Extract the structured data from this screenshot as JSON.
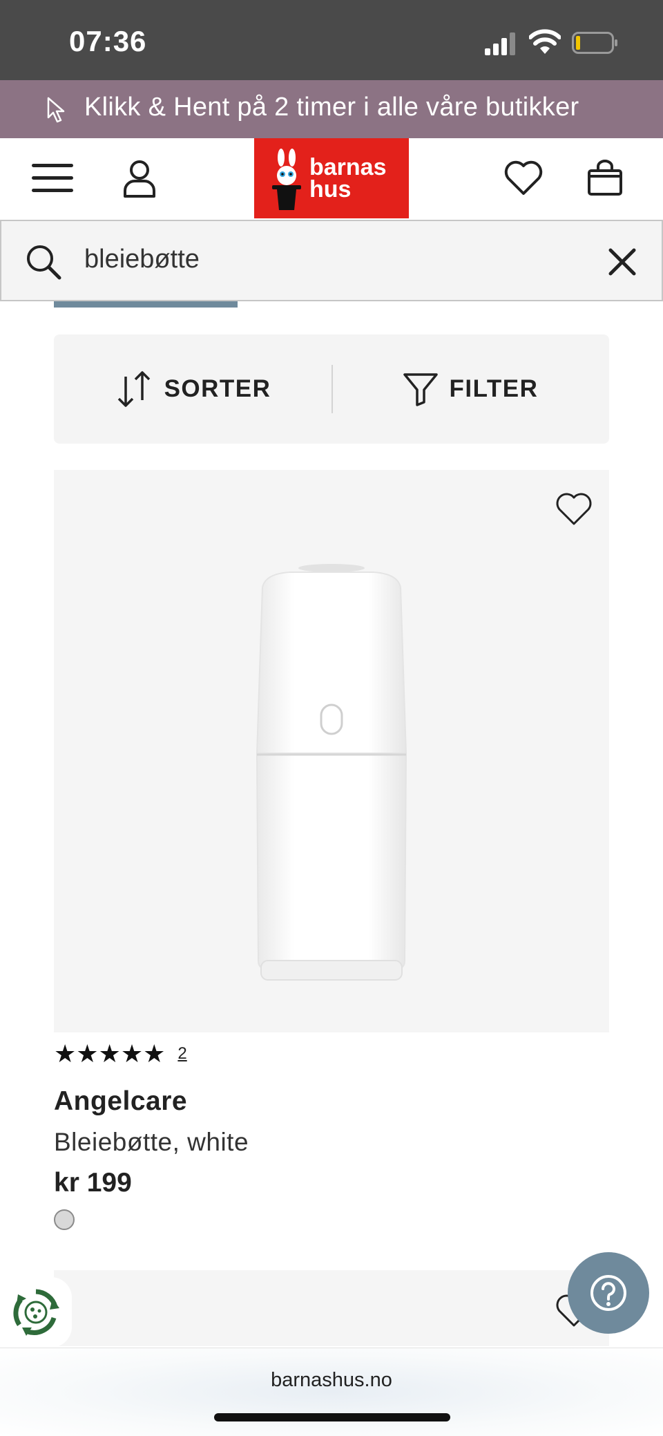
{
  "status_bar": {
    "time": "07:36",
    "icons": [
      "cellular-signal-icon",
      "wifi-icon",
      "battery-low-icon"
    ]
  },
  "promo": {
    "icon": "cursor-pointer-icon",
    "text": "Klikk & Hent på 2 timer i alle våre butikker"
  },
  "header": {
    "logo_line1": "barnas",
    "logo_line2": "hus",
    "icons": [
      "hamburger-menu-icon",
      "user-icon",
      "heart-icon",
      "shopping-bag-icon"
    ]
  },
  "search": {
    "value": "bleiebøtte",
    "icon": "search-icon",
    "clear_icon": "close-icon"
  },
  "toolbar": {
    "sort_label": "SORTER",
    "filter_label": "FILTER"
  },
  "products": [
    {
      "stars": "★★★★★",
      "rating_value": 5,
      "review_count": "2",
      "brand": "Angelcare",
      "name": "Bleiebøtte, white",
      "price": "kr 199",
      "swatch_color": "#d8d8d8"
    }
  ],
  "bottom": {
    "url": "barnashus.no"
  },
  "colors": {
    "status_bar": "#4a4a4a",
    "promo_bg": "#8c7384",
    "logo_bg": "#e3211b",
    "accent": "#6f8a9c",
    "card_bg": "#f5f5f5",
    "eco_green": "#2e6b3a"
  }
}
